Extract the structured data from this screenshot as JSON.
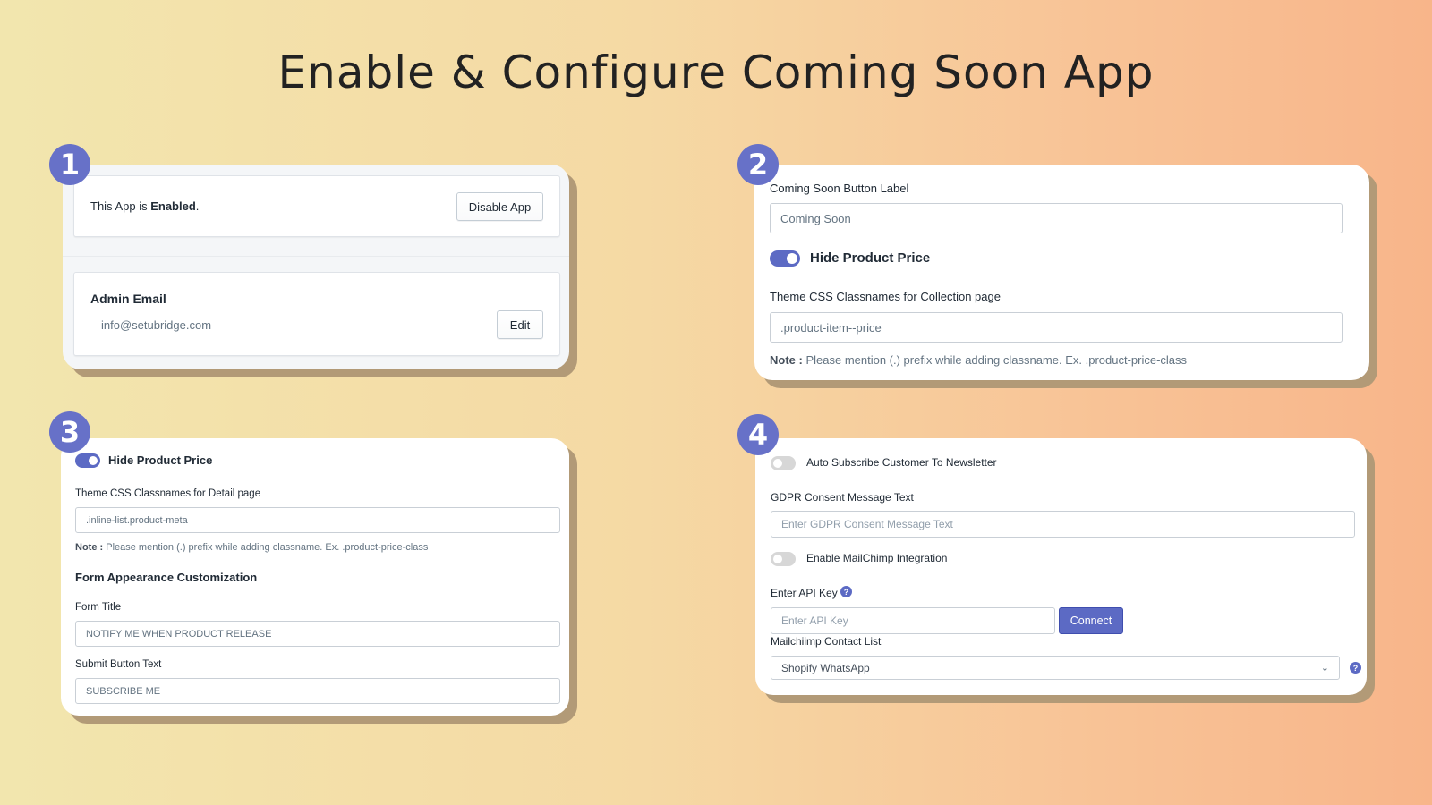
{
  "page": {
    "title": "Enable & Configure Coming Soon App"
  },
  "colors": {
    "accent": "#5c6ac4",
    "badge": "#6771c8",
    "panel_shadow": "#b29a77"
  },
  "step1": {
    "badge": "1",
    "status_prefix": "This App is ",
    "status_value": "Enabled",
    "status_suffix": ".",
    "disable_button": "Disable App",
    "admin_email_title": "Admin Email",
    "admin_email_value": "info@setubridge.com",
    "edit_button": "Edit"
  },
  "step2": {
    "badge": "2",
    "button_label_title": "Coming Soon Button Label",
    "button_label_value": "Coming Soon",
    "hide_price_label": "Hide Product Price",
    "hide_price_on": true,
    "collection_css_title": "Theme CSS Classnames for Collection page",
    "collection_css_value": ".product-item--price",
    "note_label": "Note :",
    "note_text": " Please mention (.) prefix while adding classname. Ex. .product-price-class"
  },
  "step3": {
    "badge": "3",
    "hide_price_label": "Hide Product Price",
    "hide_price_on": true,
    "detail_css_title": "Theme CSS Classnames for Detail page",
    "detail_css_value": ".inline-list.product-meta",
    "note_label": "Note :",
    "note_text": " Please mention (.) prefix while adding classname. Ex. .product-price-class",
    "section_title": "Form Appearance Customization",
    "form_title_label": "Form Title",
    "form_title_value": "NOTIFY ME WHEN PRODUCT RELEASE",
    "submit_text_label": "Submit Button Text",
    "submit_text_value": "SUBSCRIBE ME"
  },
  "step4": {
    "badge": "4",
    "auto_subscribe_label": "Auto Subscribe Customer To Newsletter",
    "auto_subscribe_on": false,
    "gdpr_label": "GDPR Consent Message Text",
    "gdpr_placeholder": "Enter GDPR Consent Message Text",
    "mailchimp_label": "Enable MailChimp Integration",
    "mailchimp_on": false,
    "api_key_label": "Enter API Key",
    "api_key_placeholder": "Enter API Key",
    "connect_button": "Connect",
    "contact_list_label": "Mailchiimp Contact List",
    "contact_list_selected": "Shopify WhatsApp",
    "help_glyph": "?",
    "chevron_glyph": "⌄"
  }
}
